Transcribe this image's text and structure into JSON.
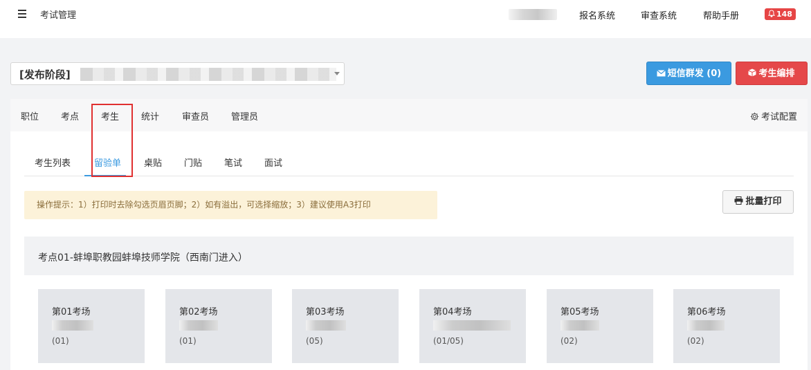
{
  "header": {
    "app_title": "考试管理",
    "nav": [
      "报名系统",
      "审查系统",
      "帮助手册"
    ],
    "notification_count": "148"
  },
  "exam": {
    "select_label": "[发布阶段]"
  },
  "actions": {
    "sms_label": "短信群发 (0)",
    "arrange_label": "考生编排"
  },
  "main_tabs": [
    "职位",
    "考点",
    "考生",
    "统计",
    "审查员",
    "管理员"
  ],
  "active_main_tab": "考生",
  "config_label": "考试配置",
  "sub_tabs": [
    "考生列表",
    "留验单",
    "桌贴",
    "门贴",
    "笔试",
    "面试"
  ],
  "active_sub_tab": "留验单",
  "hint": "操作提示：1）打印时去除勾选页眉页脚；2）如有溢出，可选择缩放；3）建议使用A3打印",
  "print_label": "批量打印",
  "site": {
    "title": "考点01-蚌埠职教园蚌埠技师学院（西南门进入）",
    "rooms": [
      {
        "name": "第01考场",
        "code": "(01)"
      },
      {
        "name": "第02考场",
        "code": "(01)"
      },
      {
        "name": "第03考场",
        "code": "(05)"
      },
      {
        "name": "第04考场",
        "code": "(01/05)"
      },
      {
        "name": "第05考场",
        "code": "(02)"
      },
      {
        "name": "第06考场",
        "code": "(02)"
      }
    ]
  },
  "colors": {
    "primary": "#3b9ae0",
    "danger": "#e5484a",
    "warning_bg": "#fcf2d9",
    "highlight_box": "#e03030"
  }
}
